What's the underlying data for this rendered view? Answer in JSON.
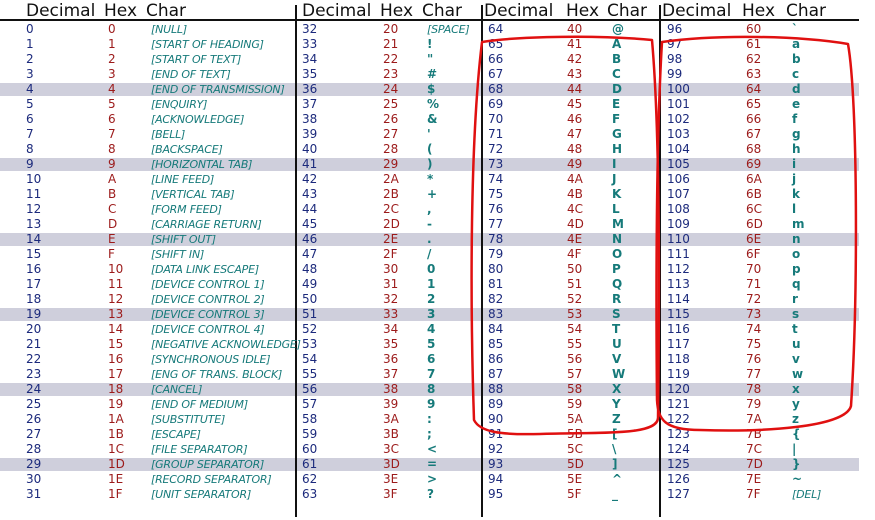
{
  "headers": {
    "decimal": "Decimal",
    "hex": "Hex",
    "char": "Char"
  },
  "annotation_color": "#e01010",
  "highlight_rows": [
    4,
    9,
    14,
    19,
    24,
    29
  ],
  "columns": [
    {
      "rows": [
        {
          "dec": "0",
          "hex": "0",
          "char": "[NULL]"
        },
        {
          "dec": "1",
          "hex": "1",
          "char": "[START OF HEADING]"
        },
        {
          "dec": "2",
          "hex": "2",
          "char": "[START OF TEXT]"
        },
        {
          "dec": "3",
          "hex": "3",
          "char": "[END OF TEXT]"
        },
        {
          "dec": "4",
          "hex": "4",
          "char": "[END OF TRANSMISSION]"
        },
        {
          "dec": "5",
          "hex": "5",
          "char": "[ENQUIRY]"
        },
        {
          "dec": "6",
          "hex": "6",
          "char": "[ACKNOWLEDGE]"
        },
        {
          "dec": "7",
          "hex": "7",
          "char": "[BELL]"
        },
        {
          "dec": "8",
          "hex": "8",
          "char": "[BACKSPACE]"
        },
        {
          "dec": "9",
          "hex": "9",
          "char": "[HORIZONTAL TAB]"
        },
        {
          "dec": "10",
          "hex": "A",
          "char": "[LINE FEED]"
        },
        {
          "dec": "11",
          "hex": "B",
          "char": "[VERTICAL TAB]"
        },
        {
          "dec": "12",
          "hex": "C",
          "char": "[FORM FEED]"
        },
        {
          "dec": "13",
          "hex": "D",
          "char": "[CARRIAGE RETURN]"
        },
        {
          "dec": "14",
          "hex": "E",
          "char": "[SHIFT OUT]"
        },
        {
          "dec": "15",
          "hex": "F",
          "char": "[SHIFT IN]"
        },
        {
          "dec": "16",
          "hex": "10",
          "char": "[DATA LINK ESCAPE]"
        },
        {
          "dec": "17",
          "hex": "11",
          "char": "[DEVICE CONTROL 1]"
        },
        {
          "dec": "18",
          "hex": "12",
          "char": "[DEVICE CONTROL 2]"
        },
        {
          "dec": "19",
          "hex": "13",
          "char": "[DEVICE CONTROL 3]"
        },
        {
          "dec": "20",
          "hex": "14",
          "char": "[DEVICE CONTROL 4]"
        },
        {
          "dec": "21",
          "hex": "15",
          "char": "[NEGATIVE ACKNOWLEDGE]"
        },
        {
          "dec": "22",
          "hex": "16",
          "char": "[SYNCHRONOUS IDLE]"
        },
        {
          "dec": "23",
          "hex": "17",
          "char": "[ENG OF TRANS. BLOCK]"
        },
        {
          "dec": "24",
          "hex": "18",
          "char": "[CANCEL]"
        },
        {
          "dec": "25",
          "hex": "19",
          "char": "[END OF MEDIUM]"
        },
        {
          "dec": "26",
          "hex": "1A",
          "char": "[SUBSTITUTE]"
        },
        {
          "dec": "27",
          "hex": "1B",
          "char": "[ESCAPE]"
        },
        {
          "dec": "28",
          "hex": "1C",
          "char": "[FILE SEPARATOR]"
        },
        {
          "dec": "29",
          "hex": "1D",
          "char": "[GROUP SEPARATOR]"
        },
        {
          "dec": "30",
          "hex": "1E",
          "char": "[RECORD SEPARATOR]"
        },
        {
          "dec": "31",
          "hex": "1F",
          "char": "[UNIT SEPARATOR]"
        }
      ]
    },
    {
      "rows": [
        {
          "dec": "32",
          "hex": "20",
          "char": "[SPACE]"
        },
        {
          "dec": "33",
          "hex": "21",
          "char": "!"
        },
        {
          "dec": "34",
          "hex": "22",
          "char": "\""
        },
        {
          "dec": "35",
          "hex": "23",
          "char": "#"
        },
        {
          "dec": "36",
          "hex": "24",
          "char": "$"
        },
        {
          "dec": "37",
          "hex": "25",
          "char": "%"
        },
        {
          "dec": "38",
          "hex": "26",
          "char": "&"
        },
        {
          "dec": "39",
          "hex": "27",
          "char": "'"
        },
        {
          "dec": "40",
          "hex": "28",
          "char": "("
        },
        {
          "dec": "41",
          "hex": "29",
          "char": ")"
        },
        {
          "dec": "42",
          "hex": "2A",
          "char": "*"
        },
        {
          "dec": "43",
          "hex": "2B",
          "char": "+"
        },
        {
          "dec": "44",
          "hex": "2C",
          "char": ","
        },
        {
          "dec": "45",
          "hex": "2D",
          "char": "-"
        },
        {
          "dec": "46",
          "hex": "2E",
          "char": "."
        },
        {
          "dec": "47",
          "hex": "2F",
          "char": "/"
        },
        {
          "dec": "48",
          "hex": "30",
          "char": "0"
        },
        {
          "dec": "49",
          "hex": "31",
          "char": "1"
        },
        {
          "dec": "50",
          "hex": "32",
          "char": "2"
        },
        {
          "dec": "51",
          "hex": "33",
          "char": "3"
        },
        {
          "dec": "52",
          "hex": "34",
          "char": "4"
        },
        {
          "dec": "53",
          "hex": "35",
          "char": "5"
        },
        {
          "dec": "54",
          "hex": "36",
          "char": "6"
        },
        {
          "dec": "55",
          "hex": "37",
          "char": "7"
        },
        {
          "dec": "56",
          "hex": "38",
          "char": "8"
        },
        {
          "dec": "57",
          "hex": "39",
          "char": "9"
        },
        {
          "dec": "58",
          "hex": "3A",
          "char": ":"
        },
        {
          "dec": "59",
          "hex": "3B",
          "char": ";"
        },
        {
          "dec": "60",
          "hex": "3C",
          "char": "<"
        },
        {
          "dec": "61",
          "hex": "3D",
          "char": "="
        },
        {
          "dec": "62",
          "hex": "3E",
          "char": ">"
        },
        {
          "dec": "63",
          "hex": "3F",
          "char": "?"
        }
      ]
    },
    {
      "rows": [
        {
          "dec": "64",
          "hex": "40",
          "char": "@"
        },
        {
          "dec": "65",
          "hex": "41",
          "char": "A"
        },
        {
          "dec": "66",
          "hex": "42",
          "char": "B"
        },
        {
          "dec": "67",
          "hex": "43",
          "char": "C"
        },
        {
          "dec": "68",
          "hex": "44",
          "char": "D"
        },
        {
          "dec": "69",
          "hex": "45",
          "char": "E"
        },
        {
          "dec": "70",
          "hex": "46",
          "char": "F"
        },
        {
          "dec": "71",
          "hex": "47",
          "char": "G"
        },
        {
          "dec": "72",
          "hex": "48",
          "char": "H"
        },
        {
          "dec": "73",
          "hex": "49",
          "char": "I"
        },
        {
          "dec": "74",
          "hex": "4A",
          "char": "J"
        },
        {
          "dec": "75",
          "hex": "4B",
          "char": "K"
        },
        {
          "dec": "76",
          "hex": "4C",
          "char": "L"
        },
        {
          "dec": "77",
          "hex": "4D",
          "char": "M"
        },
        {
          "dec": "78",
          "hex": "4E",
          "char": "N"
        },
        {
          "dec": "79",
          "hex": "4F",
          "char": "O"
        },
        {
          "dec": "80",
          "hex": "50",
          "char": "P"
        },
        {
          "dec": "81",
          "hex": "51",
          "char": "Q"
        },
        {
          "dec": "82",
          "hex": "52",
          "char": "R"
        },
        {
          "dec": "83",
          "hex": "53",
          "char": "S"
        },
        {
          "dec": "84",
          "hex": "54",
          "char": "T"
        },
        {
          "dec": "85",
          "hex": "55",
          "char": "U"
        },
        {
          "dec": "86",
          "hex": "56",
          "char": "V"
        },
        {
          "dec": "87",
          "hex": "57",
          "char": "W"
        },
        {
          "dec": "88",
          "hex": "58",
          "char": "X"
        },
        {
          "dec": "89",
          "hex": "59",
          "char": "Y"
        },
        {
          "dec": "90",
          "hex": "5A",
          "char": "Z"
        },
        {
          "dec": "91",
          "hex": "5B",
          "char": "["
        },
        {
          "dec": "92",
          "hex": "5C",
          "char": "\\"
        },
        {
          "dec": "93",
          "hex": "5D",
          "char": "]"
        },
        {
          "dec": "94",
          "hex": "5E",
          "char": "^"
        },
        {
          "dec": "95",
          "hex": "5F",
          "char": "_"
        }
      ]
    },
    {
      "rows": [
        {
          "dec": "96",
          "hex": "60",
          "char": "`"
        },
        {
          "dec": "97",
          "hex": "61",
          "char": "a"
        },
        {
          "dec": "98",
          "hex": "62",
          "char": "b"
        },
        {
          "dec": "99",
          "hex": "63",
          "char": "c"
        },
        {
          "dec": "100",
          "hex": "64",
          "char": "d"
        },
        {
          "dec": "101",
          "hex": "65",
          "char": "e"
        },
        {
          "dec": "102",
          "hex": "66",
          "char": "f"
        },
        {
          "dec": "103",
          "hex": "67",
          "char": "g"
        },
        {
          "dec": "104",
          "hex": "68",
          "char": "h"
        },
        {
          "dec": "105",
          "hex": "69",
          "char": "i"
        },
        {
          "dec": "106",
          "hex": "6A",
          "char": "j"
        },
        {
          "dec": "107",
          "hex": "6B",
          "char": "k"
        },
        {
          "dec": "108",
          "hex": "6C",
          "char": "l"
        },
        {
          "dec": "109",
          "hex": "6D",
          "char": "m"
        },
        {
          "dec": "110",
          "hex": "6E",
          "char": "n"
        },
        {
          "dec": "111",
          "hex": "6F",
          "char": "o"
        },
        {
          "dec": "112",
          "hex": "70",
          "char": "p"
        },
        {
          "dec": "113",
          "hex": "71",
          "char": "q"
        },
        {
          "dec": "114",
          "hex": "72",
          "char": "r"
        },
        {
          "dec": "115",
          "hex": "73",
          "char": "s"
        },
        {
          "dec": "116",
          "hex": "74",
          "char": "t"
        },
        {
          "dec": "117",
          "hex": "75",
          "char": "u"
        },
        {
          "dec": "118",
          "hex": "76",
          "char": "v"
        },
        {
          "dec": "119",
          "hex": "77",
          "char": "w"
        },
        {
          "dec": "120",
          "hex": "78",
          "char": "x"
        },
        {
          "dec": "121",
          "hex": "79",
          "char": "y"
        },
        {
          "dec": "122",
          "hex": "7A",
          "char": "z"
        },
        {
          "dec": "123",
          "hex": "7B",
          "char": "{"
        },
        {
          "dec": "124",
          "hex": "7C",
          "char": "|"
        },
        {
          "dec": "125",
          "hex": "7D",
          "char": "}"
        },
        {
          "dec": "126",
          "hex": "7E",
          "char": "~"
        },
        {
          "dec": "127",
          "hex": "7F",
          "char": "[DEL]"
        }
      ]
    }
  ]
}
